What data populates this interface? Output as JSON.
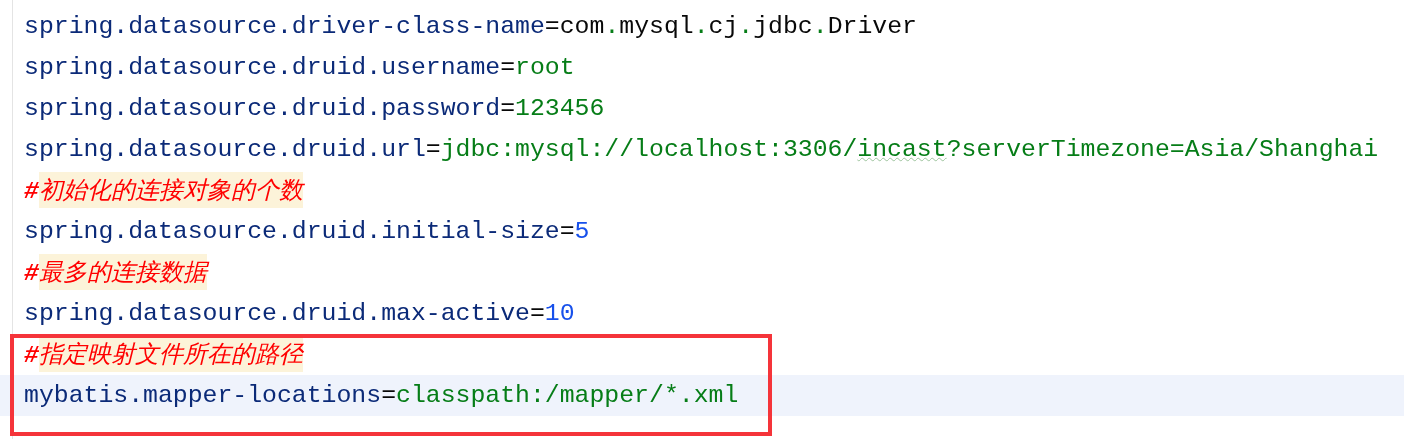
{
  "editor": {
    "lines": [
      {
        "kind": "property",
        "key": "spring.datasource.driver-class-name",
        "separator": "=",
        "current": false,
        "boxed": false,
        "value": [
          {
            "text": "com",
            "kind": "class",
            "misspelled": false
          },
          {
            "text": ".",
            "kind": "string",
            "misspelled": false
          },
          {
            "text": "mysql",
            "kind": "class",
            "misspelled": false
          },
          {
            "text": ".",
            "kind": "string",
            "misspelled": false
          },
          {
            "text": "cj",
            "kind": "class",
            "misspelled": false
          },
          {
            "text": ".",
            "kind": "string",
            "misspelled": false
          },
          {
            "text": "jdbc",
            "kind": "class",
            "misspelled": false
          },
          {
            "text": ".",
            "kind": "string",
            "misspelled": false
          },
          {
            "text": "Driver",
            "kind": "class",
            "misspelled": false
          }
        ]
      },
      {
        "kind": "property",
        "key": "spring.datasource.druid.username",
        "separator": "=",
        "current": false,
        "boxed": false,
        "value": [
          {
            "text": "root",
            "kind": "string",
            "misspelled": false
          }
        ]
      },
      {
        "kind": "property",
        "key": "spring.datasource.druid.password",
        "separator": "=",
        "current": false,
        "boxed": false,
        "value": [
          {
            "text": "123456",
            "kind": "string",
            "misspelled": false
          }
        ]
      },
      {
        "kind": "property",
        "key": "spring.datasource.druid.url",
        "separator": "=",
        "current": false,
        "boxed": false,
        "value": [
          {
            "text": "jdbc:mysql://localhost:3306/",
            "kind": "string",
            "misspelled": false
          },
          {
            "text": "incast",
            "kind": "string",
            "misspelled": true
          },
          {
            "text": "?serverTimezone=Asia/Shanghai",
            "kind": "string",
            "misspelled": false
          }
        ]
      },
      {
        "kind": "comment",
        "marker": "#",
        "text": "初始化的连接对象的个数",
        "current": false,
        "boxed": false
      },
      {
        "kind": "property",
        "key": "spring.datasource.druid.initial-size",
        "separator": "=",
        "current": false,
        "boxed": false,
        "value": [
          {
            "text": "5",
            "kind": "number",
            "misspelled": false
          }
        ]
      },
      {
        "kind": "comment",
        "marker": "#",
        "text": "最多的连接数据",
        "current": false,
        "boxed": false
      },
      {
        "kind": "property",
        "key": "spring.datasource.druid.max-active",
        "separator": "=",
        "current": false,
        "boxed": false,
        "value": [
          {
            "text": "10",
            "kind": "number",
            "misspelled": false
          }
        ]
      },
      {
        "kind": "comment",
        "marker": "#",
        "text": "指定映射文件所在的路径",
        "current": false,
        "boxed": true
      },
      {
        "kind": "property",
        "key": "mybatis.mapper-locations",
        "separator": "=",
        "current": true,
        "boxed": true,
        "value": [
          {
            "text": "classpath:/mapper/*.xml",
            "kind": "string",
            "misspelled": false
          }
        ]
      }
    ]
  }
}
